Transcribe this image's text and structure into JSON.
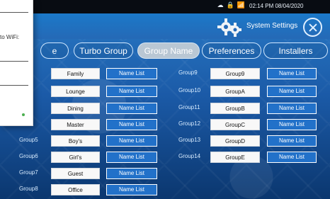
{
  "status_bar": {
    "time_text": "02:14 PM 08/04/2020",
    "icons": [
      "cloud-sync-icon",
      "lock-icon",
      "wifi-icon"
    ]
  },
  "header": {
    "settings_label": "System Settings"
  },
  "tabs": {
    "items": [
      {
        "label": "Turbo Group",
        "active": false
      },
      {
        "label": "Group Name",
        "active": true
      },
      {
        "label": "Preferences",
        "active": false
      },
      {
        "label": "Installers",
        "active": false
      }
    ],
    "partial_left_label": "e"
  },
  "groups_left": [
    {
      "label": "",
      "name": "Family",
      "button": "Name List"
    },
    {
      "label": "",
      "name": "Lounge",
      "button": "Name List"
    },
    {
      "label": "",
      "name": "Dining",
      "button": "Name List"
    },
    {
      "label": "",
      "name": "Master",
      "button": "Name List"
    },
    {
      "label": "Group5",
      "name": "Boy's",
      "button": "Name List"
    },
    {
      "label": "Group6",
      "name": "Girl's",
      "button": "Name List"
    },
    {
      "label": "Group7",
      "name": "Guest",
      "button": "Name List"
    },
    {
      "label": "Group8",
      "name": "Office",
      "button": "Name List"
    }
  ],
  "groups_right": [
    {
      "label": "Group9",
      "name": "Group9",
      "button": "Name List"
    },
    {
      "label": "Group10",
      "name": "GroupA",
      "button": "Name List"
    },
    {
      "label": "Group11",
      "name": "GroupB",
      "button": "Name List"
    },
    {
      "label": "Group12",
      "name": "GroupC",
      "button": "Name List"
    },
    {
      "label": "Group13",
      "name": "GroupD",
      "button": "Name List"
    },
    {
      "label": "Group14",
      "name": "GroupE",
      "button": "Name List"
    }
  ],
  "wifi_popup": {
    "partial_text": "to WiFi:"
  }
}
